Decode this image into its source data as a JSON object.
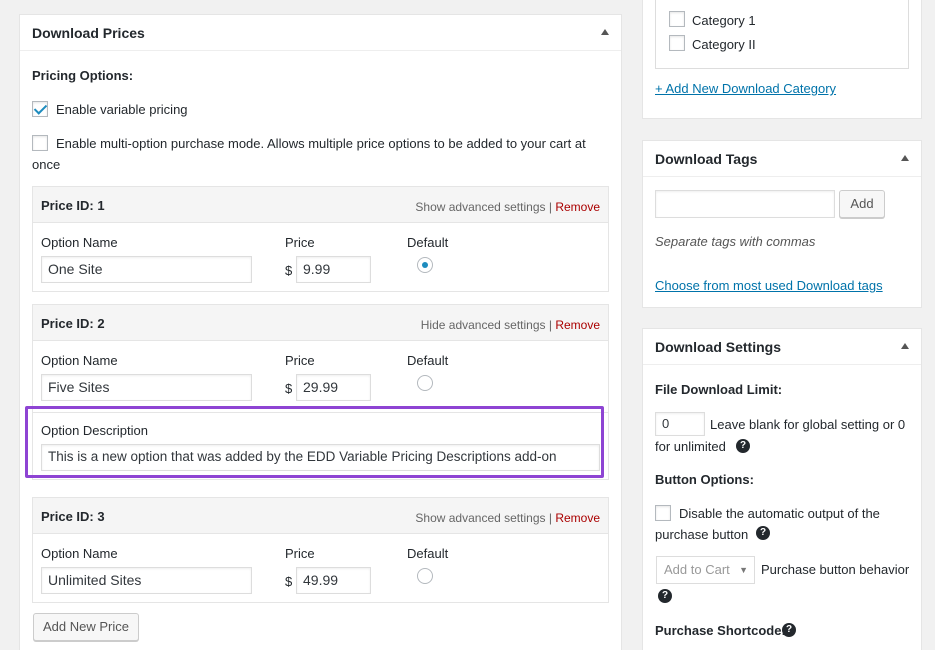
{
  "download_prices": {
    "title": "Download Prices",
    "pricing_options_label": "Pricing Options:",
    "enable_variable_label": "Enable variable pricing",
    "enable_multi_label_line1": "Enable multi-option purchase mode. Allows multiple price options to be added to your cart at",
    "enable_multi_label_line2": "once",
    "col_option_name": "Option Name",
    "col_price": "Price",
    "col_default": "Default",
    "currency": "$",
    "remove_label": "Remove",
    "separator": "|",
    "prices": [
      {
        "id_label": "Price ID: 1",
        "toggle_label": "Show advanced settings",
        "option_name": "One Site",
        "price": "9.99"
      },
      {
        "id_label": "Price ID: 2",
        "toggle_label": "Hide advanced settings",
        "option_name": "Five Sites",
        "price": "29.99",
        "option_description_label": "Option Description",
        "option_description": "This is a new option that was added by the EDD Variable Pricing Descriptions add-on"
      },
      {
        "id_label": "Price ID: 3",
        "toggle_label": "Show advanced settings",
        "option_name": "Unlimited Sites",
        "price": "49.99"
      }
    ],
    "add_new_price_label": "Add New Price"
  },
  "categories": {
    "items": [
      "Category 1",
      "Category II"
    ],
    "add_new_link": "+ Add New Download Category"
  },
  "download_tags": {
    "title": "Download Tags",
    "add_button": "Add",
    "hint": "Separate tags with commas",
    "choose_link": "Choose from most used Download tags"
  },
  "download_settings": {
    "title": "Download Settings",
    "file_limit_label": "File Download Limit:",
    "file_limit_value": "0",
    "file_limit_hint_line1": "Leave blank for global setting or 0",
    "file_limit_hint_line2": "for unlimited",
    "button_options_label": "Button Options:",
    "disable_output_line1": "Disable the automatic output of the",
    "disable_output_line2": "purchase button",
    "select_value": "Add to Cart",
    "purchase_behavior_label": "Purchase button behavior",
    "purchase_shortcode_label": "Purchase Shortcode:",
    "help_glyph": "?"
  },
  "colors": {
    "highlight": "#8e44d3",
    "link": "#0073aa",
    "remove": "#aa0000",
    "checkbox_accent": "#1e8cbe"
  }
}
